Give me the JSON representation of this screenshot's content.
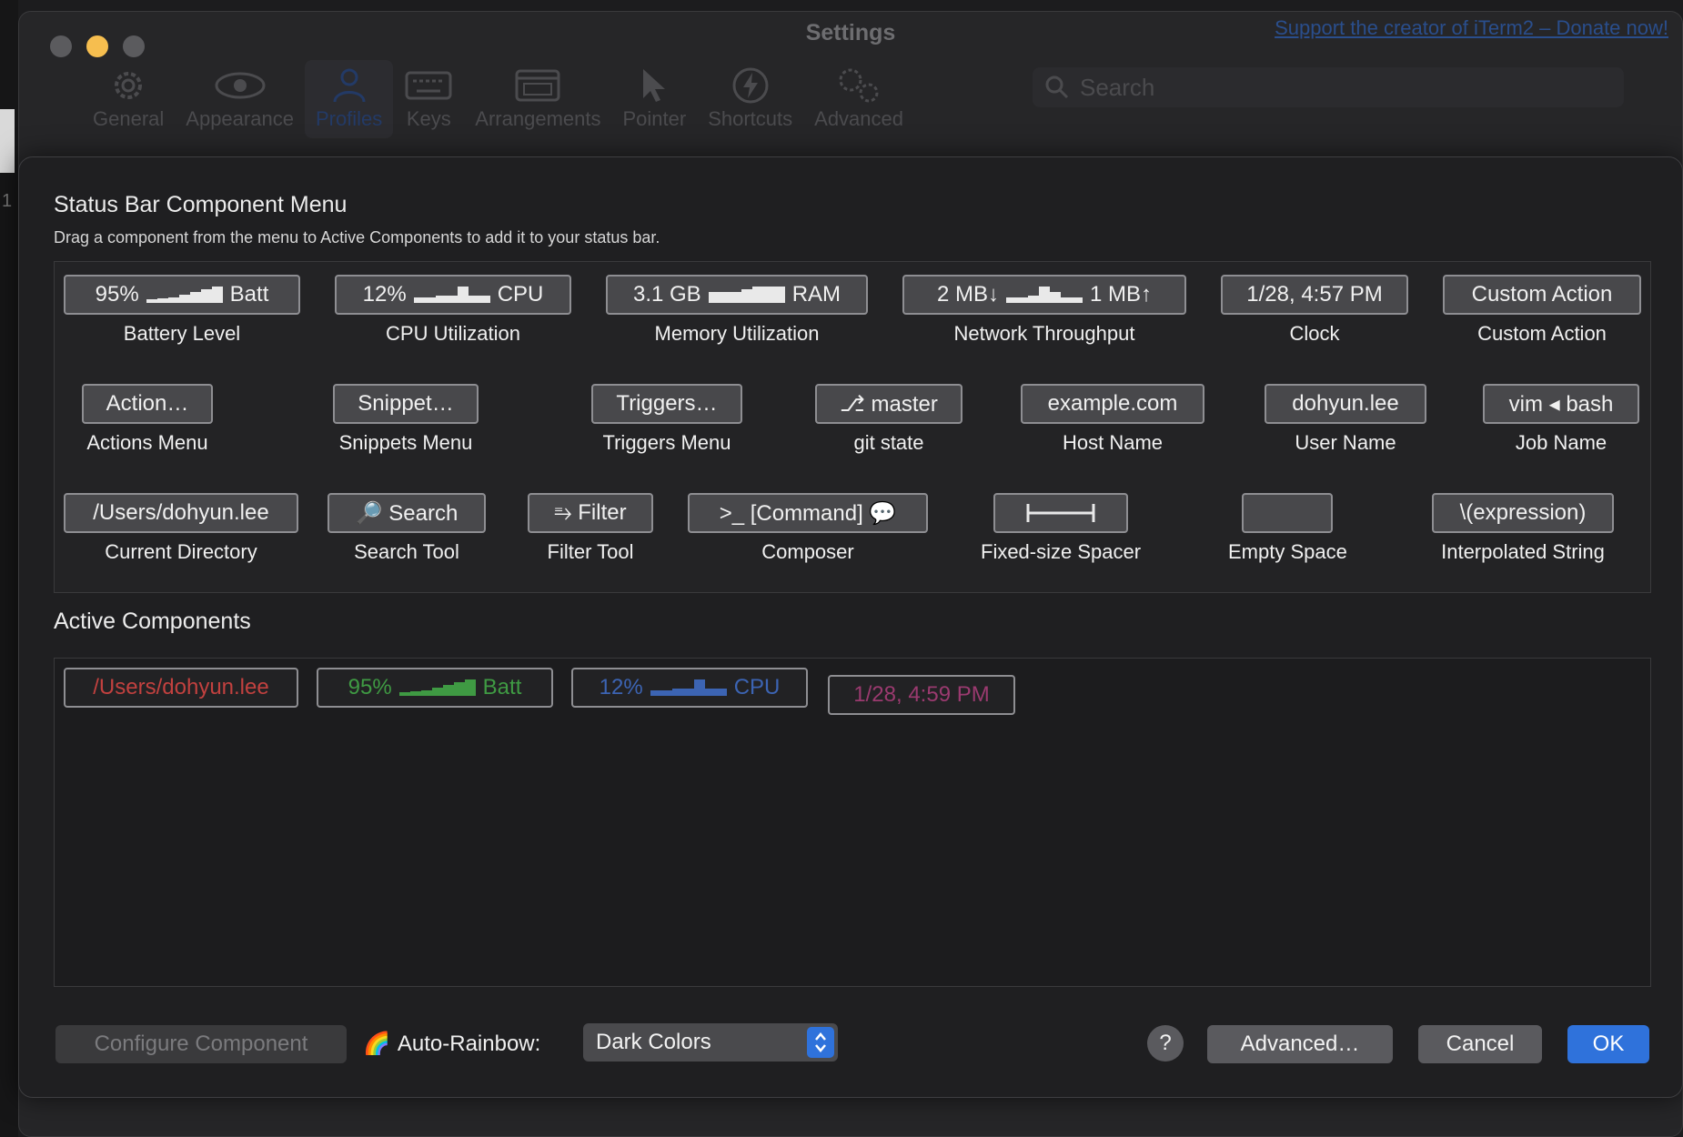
{
  "window": {
    "title": "Settings",
    "donate_link": "Support the creator of iTerm2 – Donate now!",
    "left_edge_digit": "1"
  },
  "toolbar": {
    "items": [
      {
        "label": "General",
        "icon": "gear-icon"
      },
      {
        "label": "Appearance",
        "icon": "eye-icon"
      },
      {
        "label": "Profiles",
        "icon": "person-icon",
        "active": true
      },
      {
        "label": "Keys",
        "icon": "keyboard-icon"
      },
      {
        "label": "Arrangements",
        "icon": "windows-icon"
      },
      {
        "label": "Pointer",
        "icon": "pointer-icon"
      },
      {
        "label": "Shortcuts",
        "icon": "bolt-icon"
      },
      {
        "label": "Advanced",
        "icon": "gears-icon"
      }
    ],
    "search_placeholder": "Search"
  },
  "menu": {
    "title": "Status Bar Component Menu",
    "subtitle": "Drag a component from the menu to Active Components to add it to your status bar.",
    "components": [
      {
        "pill_prefix": "95%",
        "pill_suffix": "Batt",
        "spark": [
          3,
          4,
          5,
          7,
          9,
          12,
          14
        ],
        "caption": "Battery Level"
      },
      {
        "pill_prefix": "12%",
        "pill_suffix": "CPU",
        "spark": [
          3,
          3,
          4,
          4,
          9,
          4,
          4
        ],
        "caption": "CPU Utilization"
      },
      {
        "pill_prefix": "3.1 GB",
        "pill_suffix": "RAM",
        "spark": [
          4,
          4,
          4,
          5,
          6,
          6,
          6
        ],
        "caption": "Memory Utilization"
      },
      {
        "pill_prefix": "2 MB↓",
        "pill_suffix": "1 MB↑",
        "spark": [
          3,
          3,
          4,
          9,
          6,
          3,
          3
        ],
        "caption": "Network Throughput"
      },
      {
        "pill": "1/28, 4:57 PM",
        "caption": "Clock"
      },
      {
        "pill": "Custom Action",
        "caption": "Custom Action"
      },
      {
        "pill": "Action…",
        "caption": "Actions Menu"
      },
      {
        "pill": "Snippet…",
        "caption": "Snippets Menu"
      },
      {
        "pill": "Triggers…",
        "caption": "Triggers Menu"
      },
      {
        "pill": "⎇ master",
        "caption": "git state"
      },
      {
        "pill": "example.com",
        "caption": "Host Name"
      },
      {
        "pill": "dohyun.lee",
        "caption": "User Name"
      },
      {
        "pill": "vim ◂ bash",
        "caption": "Job Name"
      },
      {
        "pill": "/Users/dohyun.lee",
        "caption": "Current Directory"
      },
      {
        "pill": "🔎 Search",
        "caption": "Search Tool"
      },
      {
        "pill": "⥱ Filter",
        "caption": "Filter Tool"
      },
      {
        "pill": ">_ [Command] 💬",
        "caption": "Composer"
      },
      {
        "pill": "",
        "caption": "Fixed-size Spacer"
      },
      {
        "pill": "",
        "caption": "Empty Space"
      },
      {
        "pill": "\\(expression)",
        "caption": "Interpolated String"
      }
    ]
  },
  "active": {
    "title": "Active Components",
    "items": [
      {
        "text": "/Users/dohyun.lee",
        "color": "#c2413f"
      },
      {
        "prefix": "95%",
        "suffix": "Batt",
        "color": "#3f9a43",
        "spark": [
          3,
          4,
          5,
          7,
          9,
          12,
          14
        ]
      },
      {
        "prefix": "12%",
        "suffix": "CPU",
        "color": "#3c64b3",
        "spark": [
          3,
          3,
          4,
          4,
          9,
          4,
          4
        ]
      },
      {
        "text": "1/28, 4:59 PM",
        "color": "#9a3a6f"
      }
    ]
  },
  "buttons": {
    "configure": "Configure Component",
    "rainbow_emoji": "🌈",
    "rainbow_label": "Auto-Rainbow:",
    "rainbow_value": "Dark Colors",
    "help": "?",
    "advanced": "Advanced…",
    "cancel": "Cancel",
    "ok": "OK"
  },
  "colors": {
    "accent": "#2f72db"
  }
}
